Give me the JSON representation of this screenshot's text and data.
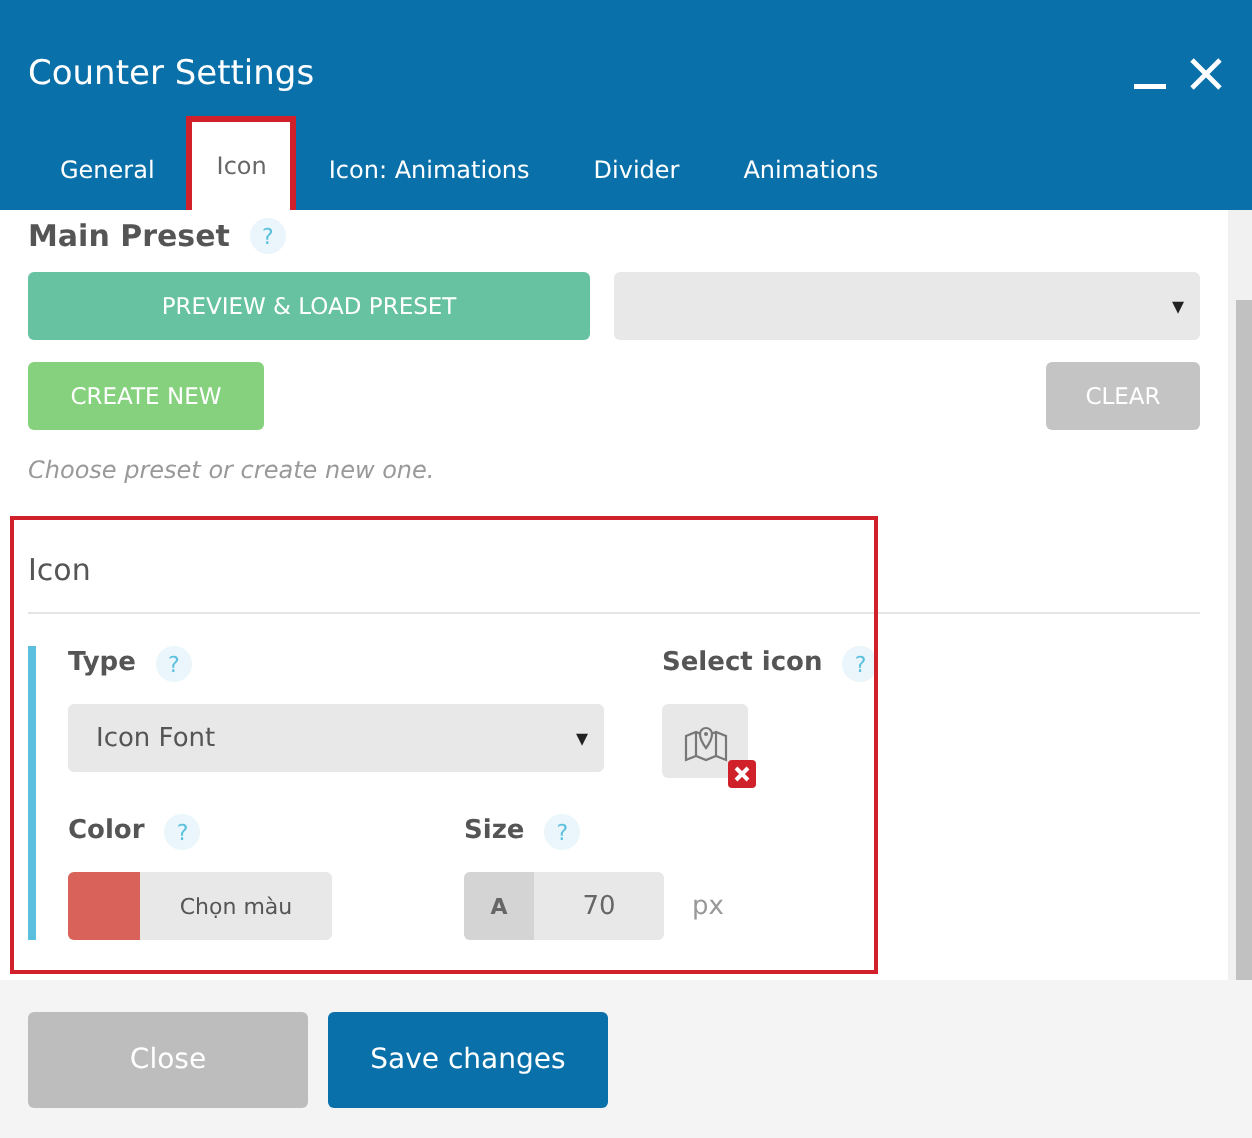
{
  "window": {
    "title": "Counter Settings"
  },
  "tabs": [
    {
      "label": "General",
      "selected": false
    },
    {
      "label": "Icon",
      "selected": true
    },
    {
      "label": "Icon: Animations",
      "selected": false
    },
    {
      "label": "Divider",
      "selected": false
    },
    {
      "label": "Animations",
      "selected": false
    }
  ],
  "preset": {
    "heading": "Main Preset",
    "help": "?",
    "load_button": "PREVIEW & LOAD PRESET",
    "select_arrow": "▾",
    "create_button": "CREATE NEW",
    "clear_button": "CLEAR",
    "hint": "Choose preset or create new one."
  },
  "icon_section": {
    "heading": "Icon",
    "highlighted": true,
    "type": {
      "label": "Type",
      "help": "?",
      "value": "Icon Font",
      "arrow": "▾"
    },
    "select_icon": {
      "label": "Select icon",
      "help": "?"
    },
    "color": {
      "label": "Color",
      "help": "?",
      "button": "Chọn màu"
    },
    "size": {
      "label": "Size",
      "help": "?",
      "prefix": "A",
      "value": "70",
      "unit": "px"
    }
  },
  "footer": {
    "buttons": [
      {
        "label": "Close",
        "kind": "secondary"
      },
      {
        "label": "Save changes",
        "kind": "primary"
      }
    ]
  }
}
